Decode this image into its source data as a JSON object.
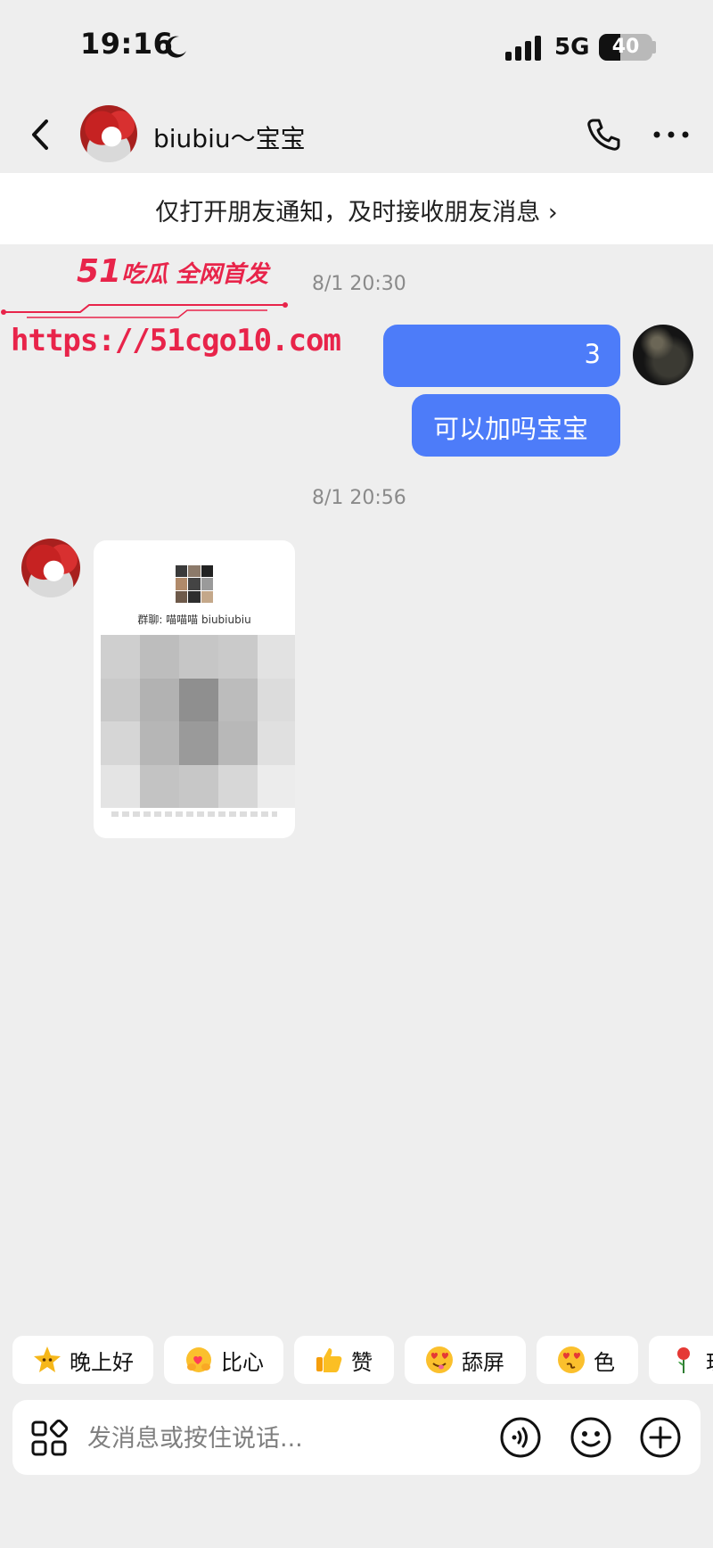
{
  "status_bar": {
    "time": "19:16",
    "network": "5G",
    "battery": "40",
    "battery_level": 0.4
  },
  "header": {
    "contact_name": "biubiu～宝宝"
  },
  "notice": {
    "text": "仅打开朋友通知，及时接收朋友消息 ›"
  },
  "watermark": {
    "line1_prefix": "51",
    "line1_suffix": "吃瓜 全网首发",
    "line2": "https://51cgo10.com"
  },
  "messages": {
    "timestamp1": "8/1 20:30",
    "msg1": "3",
    "msg2": "可以加吗宝宝",
    "timestamp2": "8/1 20:56",
    "card_title": "群聊: 喵喵喵 biubiubiu"
  },
  "quick_replies": [
    {
      "label": "晚上好",
      "icon": "star-emoji-icon"
    },
    {
      "label": "比心",
      "icon": "heart-hands-emoji-icon"
    },
    {
      "label": "赞",
      "icon": "thumbs-up-emoji-icon"
    },
    {
      "label": "舔屏",
      "icon": "heart-eyes-lick-emoji-icon"
    },
    {
      "label": "色",
      "icon": "heart-eyes-emoji-icon"
    },
    {
      "label": "玫",
      "icon": "rose-emoji-icon"
    }
  ],
  "input": {
    "placeholder": "发消息或按住说话..."
  },
  "colors": {
    "bubble": "#4d7cf9",
    "watermark": "#e8244a",
    "background": "#eeeeee"
  }
}
